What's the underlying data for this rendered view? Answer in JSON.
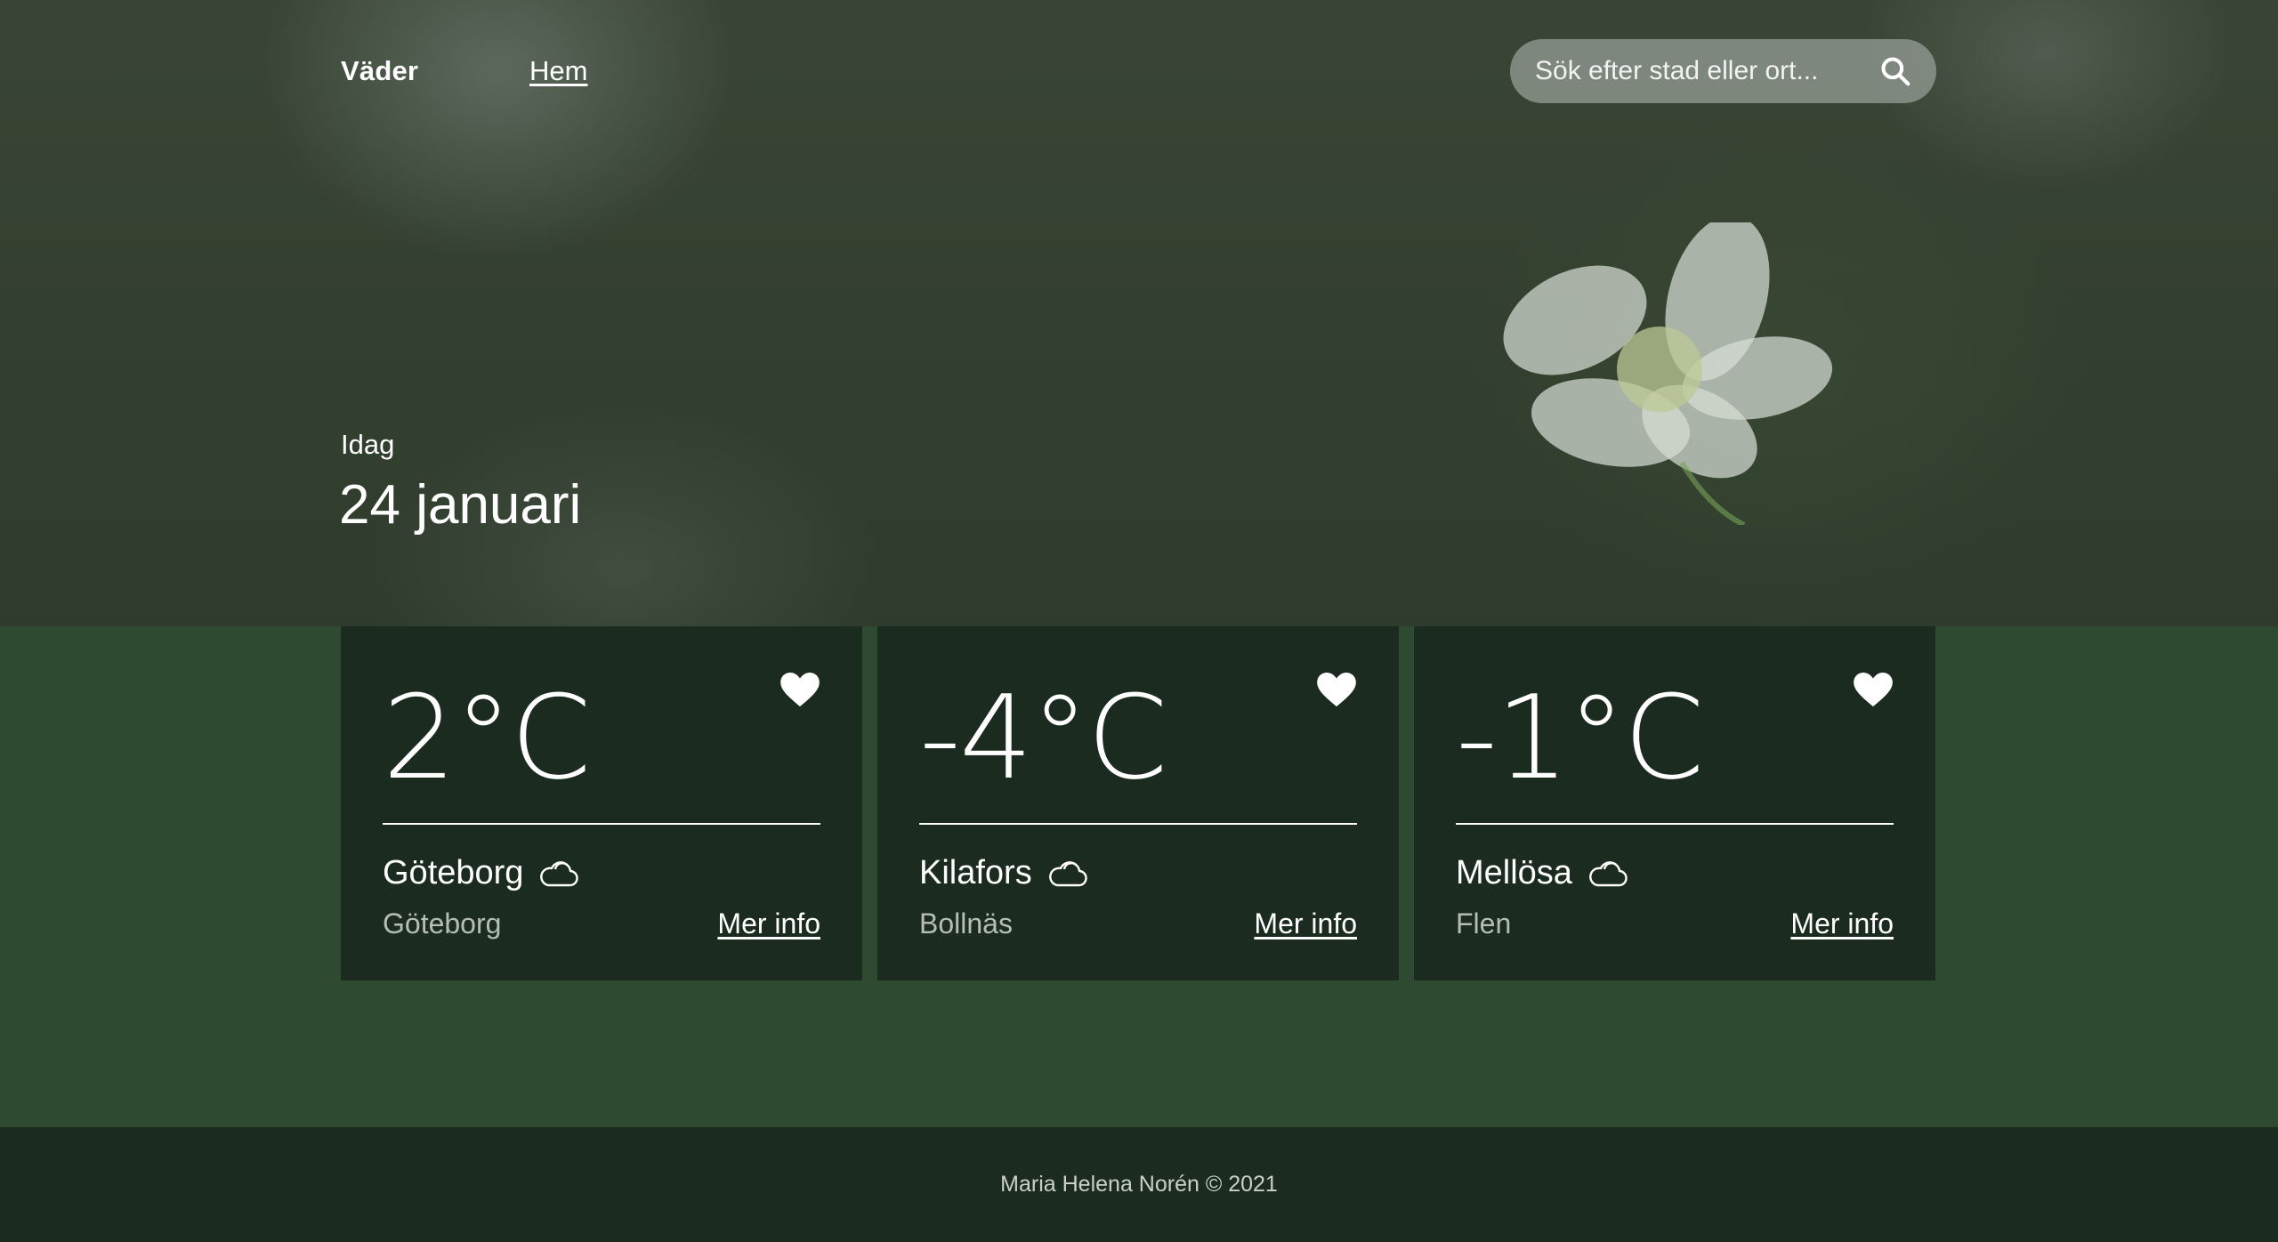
{
  "nav": {
    "brand": "Väder",
    "home_label": "Hem"
  },
  "search": {
    "placeholder": "Sök efter stad eller ort...",
    "icon": "search-icon"
  },
  "hero": {
    "subtitle": "Idag",
    "date": "24 januari"
  },
  "cards": [
    {
      "temp": "2°C",
      "city": "Göteborg",
      "region": "Göteborg",
      "more_label": "Mer info",
      "weather_icon": "cloud-icon",
      "favorite_icon": "heart-icon"
    },
    {
      "temp": "-4°C",
      "city": "Kilafors",
      "region": "Bollnäs",
      "more_label": "Mer info",
      "weather_icon": "cloud-icon",
      "favorite_icon": "heart-icon"
    },
    {
      "temp": "-1°C",
      "city": "Mellösa",
      "region": "Flen",
      "more_label": "Mer info",
      "weather_icon": "cloud-icon",
      "favorite_icon": "heart-icon"
    }
  ],
  "footer": {
    "text": "Maria Helena Norén © 2021"
  },
  "colors": {
    "page_bg": "#2e4a30",
    "card_bg": "#1c2b1f",
    "footer_bg": "#1c2b1f",
    "muted_text": "#b4bdb6"
  }
}
